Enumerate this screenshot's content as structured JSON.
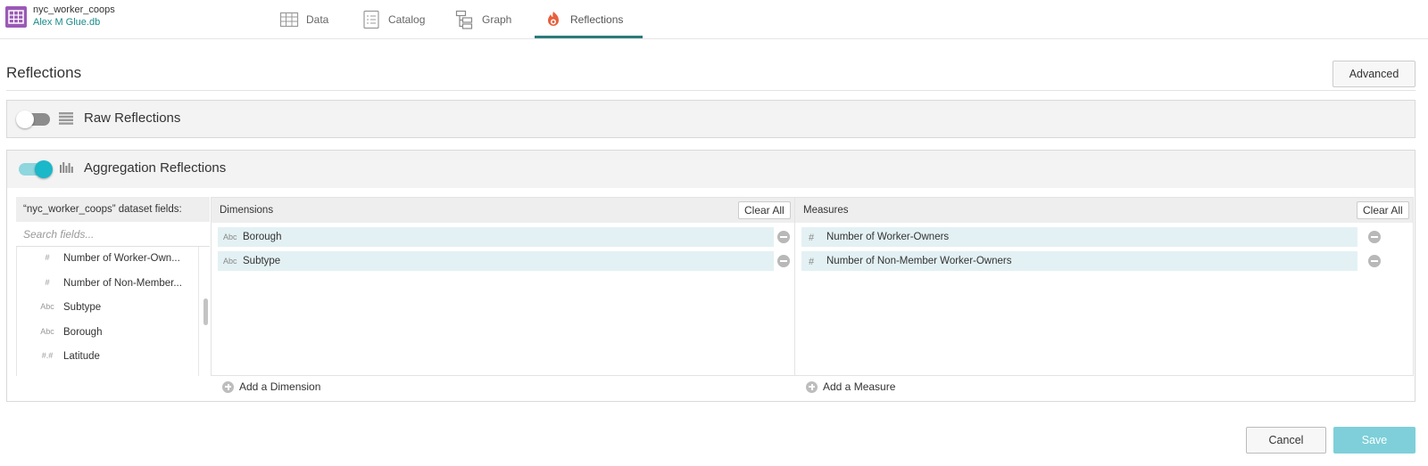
{
  "dataset": {
    "name": "nyc_worker_coops",
    "path": "Alex M Glue.db"
  },
  "tabs": [
    {
      "label": "Data",
      "icon": "table-grid-icon"
    },
    {
      "label": "Catalog",
      "icon": "catalog-icon"
    },
    {
      "label": "Graph",
      "icon": "graph-icon"
    },
    {
      "label": "Reflections",
      "icon": "reflections-icon",
      "active": true
    }
  ],
  "page": {
    "title": "Reflections",
    "advanced_label": "Advanced"
  },
  "raw": {
    "label": "Raw Reflections",
    "enabled": false
  },
  "aggregation": {
    "label": "Aggregation Reflections",
    "enabled": true,
    "fields_header": "“nyc_worker_coops” dataset fields:",
    "search_placeholder": "Search fields...",
    "fields": [
      {
        "type": "#",
        "name": "Number of Worker-Own..."
      },
      {
        "type": "#",
        "name": "Number of Non-Member..."
      },
      {
        "type": "Abc",
        "name": "Subtype"
      },
      {
        "type": "Abc",
        "name": "Borough"
      },
      {
        "type": "#.#",
        "name": "Latitude"
      }
    ],
    "dimensions": {
      "label": "Dimensions",
      "clear_label": "Clear All",
      "items": [
        {
          "type": "Abc",
          "name": "Borough"
        },
        {
          "type": "Abc",
          "name": "Subtype"
        }
      ],
      "add_label": "Add a Dimension"
    },
    "measures": {
      "label": "Measures",
      "clear_label": "Clear All",
      "items": [
        {
          "type": "#",
          "name": "Number of Worker-Owners"
        },
        {
          "type": "#",
          "name": "Number of Non-Member Worker-Owners"
        }
      ],
      "add_label": "Add a Measure"
    }
  },
  "footer": {
    "cancel_label": "Cancel",
    "save_label": "Save"
  },
  "colors": {
    "accent": "#1ab8c9",
    "tab_active": "#2b7a7a",
    "reflection_icon": "#e8603c",
    "dataset_icon": "#9b59b6",
    "save": "#7ecfd9"
  }
}
